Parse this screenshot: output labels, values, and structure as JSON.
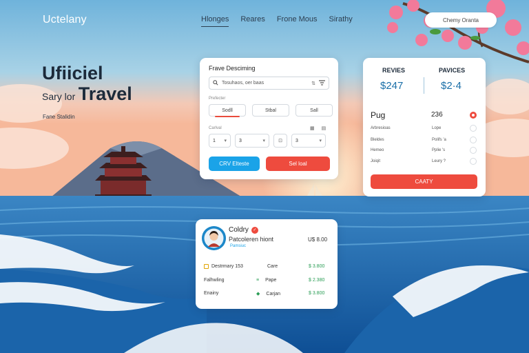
{
  "app": {
    "logo": "Uctelany"
  },
  "nav": {
    "links": [
      "Hlonges",
      "Reares",
      "Frone Mous",
      "Sirathy"
    ],
    "pill_button": "Chemy Oranta"
  },
  "hero": {
    "title": "Ufiiciel",
    "subtitle_small": "Sary lor",
    "subtitle_big": "Travel",
    "caption": "Fane Stalidin"
  },
  "booking": {
    "title": "Frave Desciming",
    "search_value": "Tosuhaos, oer baas",
    "search_placeholder_label": "Prefecter",
    "tabs": [
      "Sodll",
      "Stbal",
      "Sall"
    ],
    "active_tab": 0,
    "selects_label": "Carlval",
    "selects": [
      "1",
      "3",
      "3"
    ],
    "primary_button": "CRV Elteste",
    "secondary_button": "Sel loal"
  },
  "pricing": {
    "col1_title": "REVIES",
    "col2_title": "PAVICES",
    "col1_price": "$247",
    "col2_price": "$2·4",
    "heading": "Pug",
    "heading_value": "236",
    "rows": [
      {
        "left": "Arbresioas",
        "right": "Lope"
      },
      {
        "left": "Bleldes",
        "right": "Polifs 'a"
      },
      {
        "left": "Hemeo",
        "right": "Pplie 's"
      },
      {
        "left": "Joiqit",
        "right": "Leury ?"
      }
    ],
    "selected_row": -1,
    "cta": "CAATY"
  },
  "profile": {
    "name": "Coldry",
    "role": "Patcoleren hiont",
    "amount": "U$ 8.00",
    "link": "Pamsiuc",
    "items": [
      {
        "label": "Destrmary 153",
        "mid": "Care",
        "value": "$ 3.800",
        "has_checkbox": true
      },
      {
        "label": "Falhwling",
        "mid": "Pape",
        "value": "$ 2.380",
        "has_checkbox": false
      },
      {
        "label": "Enainy",
        "mid": "Carjan",
        "value": "$ 3.800",
        "has_checkbox": false
      }
    ]
  },
  "colors": {
    "accent_blue": "#1aa3e8",
    "accent_red": "#ee4b3e",
    "price_blue": "#1a6fa8",
    "success_green": "#2a9d55"
  },
  "icons": {
    "search": "search-icon",
    "filter": "filter-icon",
    "chevron": "chevron-down-icon",
    "verified": "verified-badge-icon"
  }
}
